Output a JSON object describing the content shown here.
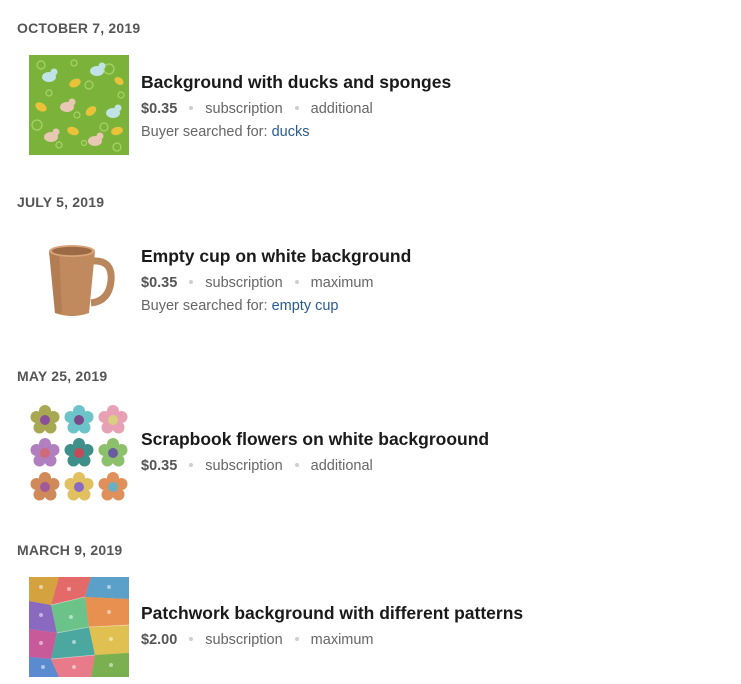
{
  "items": [
    {
      "date": "OCTOBER 7, 2019",
      "title": "Background with ducks and sponges",
      "price": "$0.35",
      "license": "subscription",
      "size": "additional",
      "search_prefix": "Buyer searched for:",
      "search_term": "ducks",
      "thumb": "ducks-sponges-thumbnail"
    },
    {
      "date": "JULY 5, 2019",
      "title": "Empty cup on white background",
      "price": "$0.35",
      "license": "subscription",
      "size": "maximum",
      "search_prefix": "Buyer searched for:",
      "search_term": "empty cup",
      "thumb": "cup-thumbnail"
    },
    {
      "date": "MAY 25, 2019",
      "title": "Scrapbook flowers on white backgroound",
      "price": "$0.35",
      "license": "subscription",
      "size": "additional",
      "thumb": "flowers-thumbnail"
    },
    {
      "date": "MARCH 9, 2019",
      "title": "Patchwork background with different patterns",
      "price": "$2.00",
      "license": "subscription",
      "size": "maximum",
      "thumb": "patchwork-thumbnail"
    }
  ],
  "colors": {
    "link": "#2a5a8c",
    "date": "#555555",
    "title": "#1a1a1a",
    "meta": "#666666"
  }
}
